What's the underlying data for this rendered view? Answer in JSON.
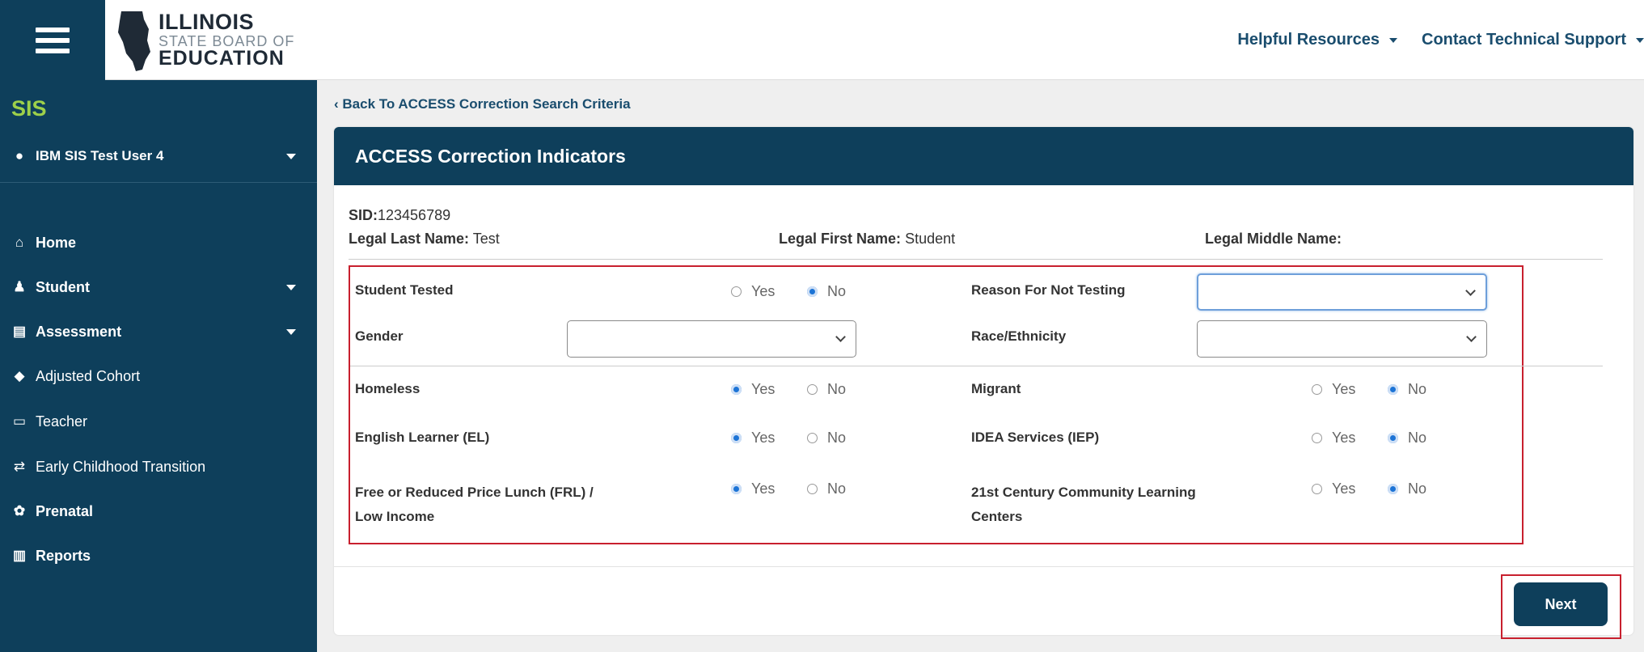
{
  "header": {
    "logo": {
      "line1": "ILLINOIS",
      "line2": "STATE BOARD OF",
      "line3": "EDUCATION"
    },
    "links": [
      "Helpful Resources",
      "Contact Technical Support"
    ]
  },
  "sidebar": {
    "app_label": "SIS",
    "user": "IBM SIS Test User 4",
    "items": [
      {
        "label": "Home",
        "icon": "home-icon",
        "glyph": "⌂"
      },
      {
        "label": "Student",
        "icon": "student-icon",
        "glyph": "♟"
      },
      {
        "label": "Assessment",
        "icon": "document-icon",
        "glyph": "▤"
      },
      {
        "label": "Adjusted Cohort",
        "icon": "graduation-cap-icon",
        "glyph": "◆"
      },
      {
        "label": "Teacher",
        "icon": "teacher-icon",
        "glyph": "▭"
      },
      {
        "label": "Early Childhood Transition",
        "icon": "exchange-icon",
        "glyph": "⇄"
      },
      {
        "label": "Prenatal",
        "icon": "baby-icon",
        "glyph": "✿"
      },
      {
        "label": "Reports",
        "icon": "chart-icon",
        "glyph": "▥"
      }
    ]
  },
  "main": {
    "back_link": "Back To ACCESS Correction Search Criteria",
    "card_title": "ACCESS Correction Indicators",
    "sid_label": "SID:",
    "sid_value": "123456789",
    "legal_last_label": "Legal Last Name:",
    "legal_last_value": "Test",
    "legal_first_label": "Legal First Name:",
    "legal_first_value": "Student",
    "legal_middle_label": "Legal Middle Name:",
    "legal_middle_value": "",
    "yes": "Yes",
    "no": "No",
    "fields": {
      "student_tested": {
        "label": "Student Tested",
        "value": "No"
      },
      "reason_not_testing": {
        "label": "Reason For Not Testing",
        "value": ""
      },
      "gender": {
        "label": "Gender",
        "value": ""
      },
      "race": {
        "label": "Race/Ethnicity",
        "value": ""
      },
      "homeless": {
        "label": "Homeless",
        "value": "Yes"
      },
      "migrant": {
        "label": "Migrant",
        "value": "No"
      },
      "el": {
        "label": "English Learner (EL)",
        "value": "Yes"
      },
      "idea": {
        "label": "IDEA Services (IEP)",
        "value": "No"
      },
      "frl": {
        "label_line1": "Free or Reduced Price Lunch (FRL) /",
        "label_line2": "Low Income",
        "value": "Yes"
      },
      "cclc": {
        "label_line1": "21st Century Community Learning",
        "label_line2": "Centers",
        "value": "No"
      }
    },
    "next_label": "Next"
  },
  "colors": {
    "navy": "#0e3f5b",
    "accent_green": "#9dd04a",
    "highlight_red": "#c8202e",
    "radio_blue": "#1d74d6"
  }
}
